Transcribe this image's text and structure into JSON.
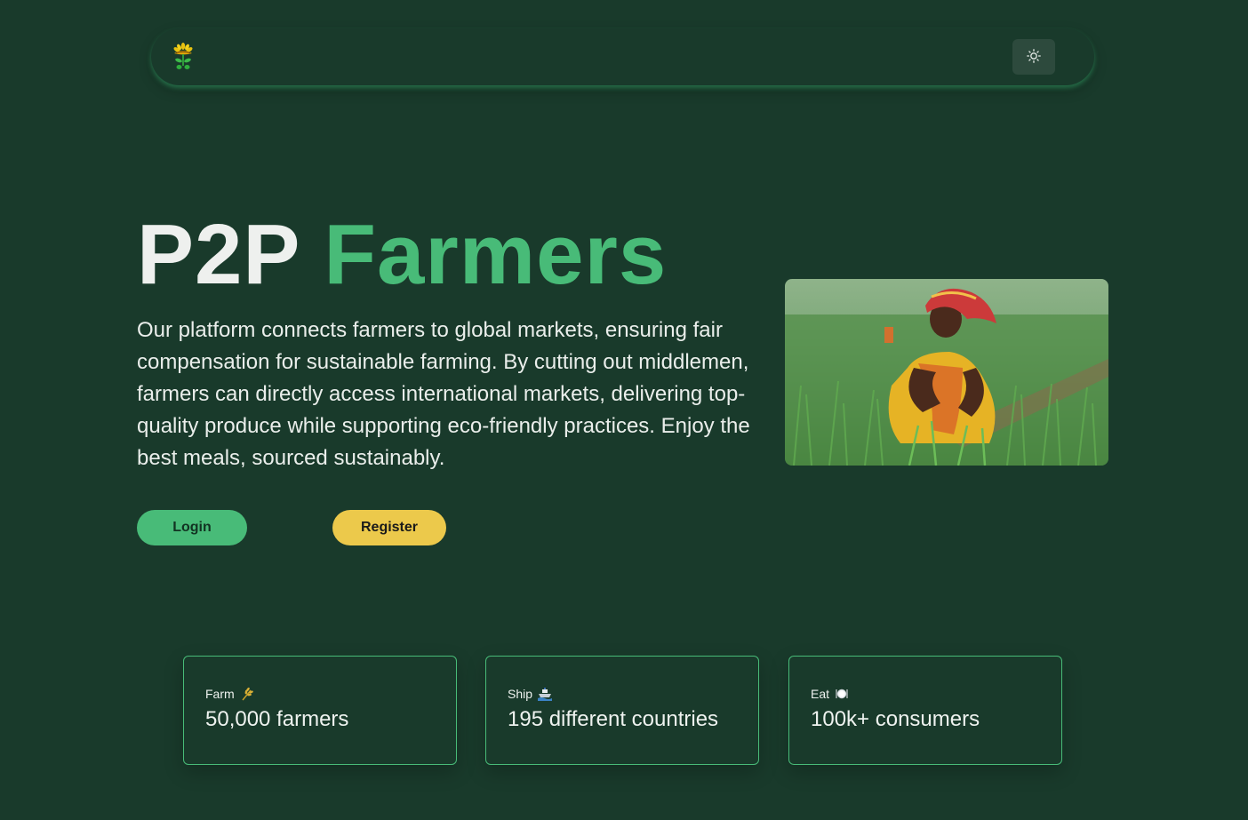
{
  "nav": {
    "logo_icon": "sunflower-logo-icon",
    "theme_toggle_icon": "sun-icon"
  },
  "hero": {
    "title_part1": "P2P",
    "title_part2": "Farmers",
    "description": "Our platform connects farmers to global markets, ensuring fair compensation for sustainable farming. By cutting out middlemen, farmers can directly access international markets, delivering top-quality produce while supporting eco-friendly practices. Enjoy the best meals, sourced sustainably.",
    "login_label": "Login",
    "register_label": "Register",
    "image": "woman-farmer-in-green-field-photo"
  },
  "stats": [
    {
      "label": "Farm",
      "icon": "wheat-icon",
      "value": "50,000 farmers"
    },
    {
      "label": "Ship",
      "icon": "ship-icon",
      "value": "195 different countries"
    },
    {
      "label": "Eat",
      "icon": "plate-cutlery-icon",
      "value": "100k+ consumers"
    }
  ],
  "colors": {
    "background": "#193a2b",
    "accent_green": "#48bb78",
    "accent_yellow": "#ecc94b"
  }
}
